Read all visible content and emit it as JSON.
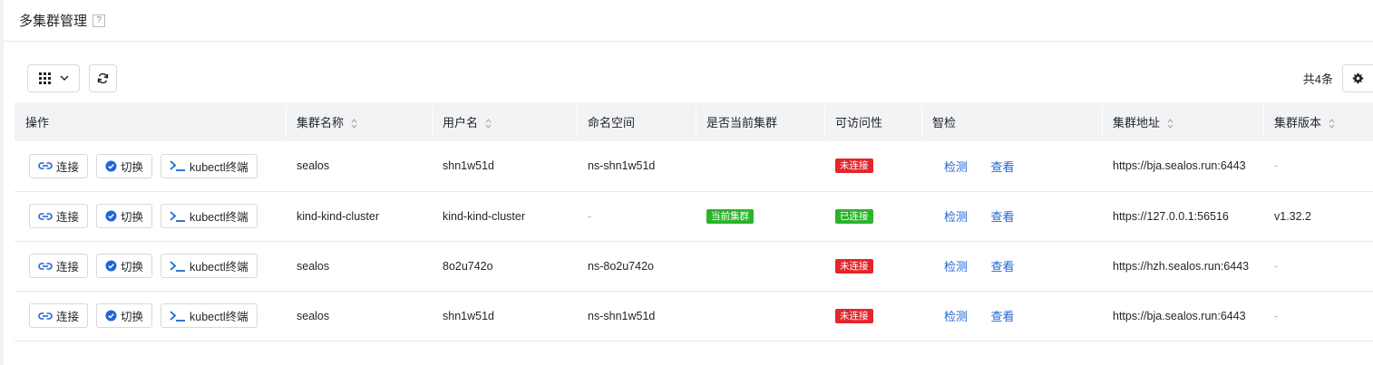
{
  "header": {
    "title": "多集群管理",
    "help": "?"
  },
  "toolbar": {
    "total": "共4条"
  },
  "columns": [
    {
      "label": "操作",
      "sortable": false
    },
    {
      "label": "集群名称",
      "sortable": true
    },
    {
      "label": "用户名",
      "sortable": true
    },
    {
      "label": "命名空间",
      "sortable": false
    },
    {
      "label": "是否当前集群",
      "sortable": false
    },
    {
      "label": "可访问性",
      "sortable": false
    },
    {
      "label": "智检",
      "sortable": false
    },
    {
      "label": "集群地址",
      "sortable": true
    },
    {
      "label": "集群版本",
      "sortable": true
    }
  ],
  "actions": {
    "connect": "连接",
    "switch": "切换",
    "terminal": "kubectl终端",
    "check": "检测",
    "view": "查看"
  },
  "rows": [
    {
      "name": "sealos",
      "user": "shn1w51d",
      "namespace": "ns-shn1w51d",
      "current": "",
      "access": "未连接",
      "access_state": "disconnected",
      "address": "https://bja.sealos.run:6443",
      "version": "-"
    },
    {
      "name": "kind-kind-cluster",
      "user": "kind-kind-cluster",
      "namespace": "-",
      "current": "当前集群",
      "access": "已连接",
      "access_state": "connected",
      "address": "https://127.0.0.1:56516",
      "version": "v1.32.2"
    },
    {
      "name": "sealos",
      "user": "8o2u742o",
      "namespace": "ns-8o2u742o",
      "current": "",
      "access": "未连接",
      "access_state": "disconnected",
      "address": "https://hzh.sealos.run:6443",
      "version": "-"
    },
    {
      "name": "sealos",
      "user": "shn1w51d",
      "namespace": "ns-shn1w51d",
      "current": "",
      "access": "未连接",
      "access_state": "disconnected",
      "address": "https://bja.sealos.run:6443",
      "version": "-"
    }
  ],
  "colors": {
    "accent": "#1f65d8",
    "danger": "#e3262b",
    "success": "#2bb32b",
    "header_bg": "#f2f3f5"
  },
  "icons": {
    "link": "link-icon",
    "switch": "check-circle-icon",
    "terminal": "terminal-icon",
    "grid": "grid-icon",
    "refresh": "refresh-icon",
    "settings": "gear-icon"
  }
}
